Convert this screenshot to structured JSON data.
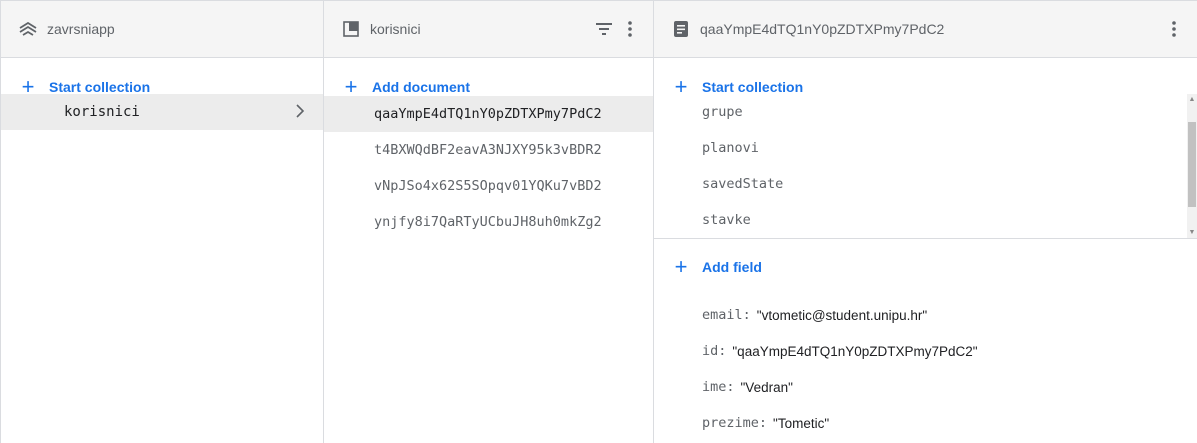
{
  "panel1": {
    "title": "zavrsniapp",
    "add_label": "Start collection",
    "items": [
      {
        "label": "korisnici"
      }
    ]
  },
  "panel2": {
    "title": "korisnici",
    "add_label": "Add document",
    "documents": [
      "qaaYmpE4dTQ1nY0pZDTXPmy7PdC2",
      "t4BXWQdBF2eavA3NJXY95k3vBDR2",
      "vNpJSo4x62S5SOpqv01YQKu7vBD2",
      "ynjfy8i7QaRTyUCbuJH8uh0mkZg2"
    ]
  },
  "panel3": {
    "title": "qaaYmpE4dTQ1nY0pZDTXPmy7PdC2",
    "add_collection_label": "Start collection",
    "subcollections": [
      "grupe",
      "planovi",
      "savedState",
      "stavke"
    ],
    "add_field_label": "Add field",
    "fields": [
      {
        "key": "email:",
        "value": "\"vtometic@student.unipu.hr\""
      },
      {
        "key": "id:",
        "value": "\"qaaYmpE4dTQ1nY0pZDTXPmy7PdC2\""
      },
      {
        "key": "ime:",
        "value": "\"Vedran\""
      },
      {
        "key": "prezime:",
        "value": "\"Tometic\""
      }
    ]
  },
  "icons": {
    "project": "project-icon",
    "collection": "collection-icon",
    "document": "document-icon",
    "filter": "filter-icon",
    "more": "more-vert-icon",
    "chevron": "chevron-right-icon"
  },
  "colors": {
    "accent": "#1a73e8",
    "selected_bg": "#ececec",
    "header_bg": "#f5f5f5"
  }
}
